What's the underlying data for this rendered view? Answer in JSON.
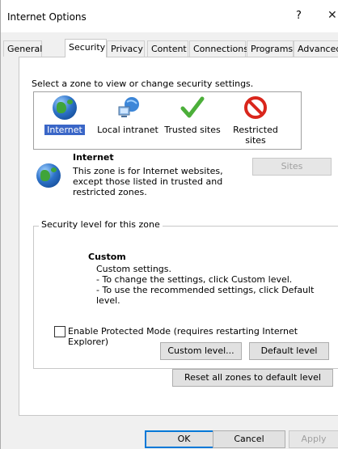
{
  "window": {
    "title": "Internet Options",
    "help_glyph": "?",
    "close_glyph": "✕"
  },
  "tabs": [
    {
      "label": "General",
      "active": false
    },
    {
      "label": "Security",
      "active": true
    },
    {
      "label": "Privacy",
      "active": false
    },
    {
      "label": "Content",
      "active": false
    },
    {
      "label": "Connections",
      "active": false
    },
    {
      "label": "Programs",
      "active": false
    },
    {
      "label": "Advanced",
      "active": false
    }
  ],
  "zones": {
    "prompt": "Select a zone to view or change security settings.",
    "items": [
      {
        "label": "Internet",
        "icon": "globe-icon",
        "selected": true
      },
      {
        "label": "Local intranet",
        "icon": "network-computer-icon",
        "selected": false
      },
      {
        "label": "Trusted sites",
        "icon": "checkmark-icon",
        "selected": false
      },
      {
        "label": "Restricted sites",
        "icon": "no-entry-icon",
        "selected": false
      }
    ]
  },
  "zone_info": {
    "title": "Internet",
    "description": "This zone is for Internet websites, except those listed in trusted and restricted zones.",
    "sites_button": "Sites"
  },
  "security_level": {
    "legend": "Security level for this zone",
    "level_title": "Custom",
    "level_desc_1": "Custom settings.",
    "level_desc_2": "- To change the settings, click Custom level.",
    "level_desc_3": "- To use the recommended settings, click Default level.",
    "protected_mode_label": "Enable Protected Mode (requires restarting Internet Explorer)",
    "protected_mode_checked": false,
    "custom_level_button": "Custom level...",
    "default_level_button": "Default level"
  },
  "reset_all_button": "Reset all zones to default level",
  "footer": {
    "ok": "OK",
    "cancel": "Cancel",
    "apply": "Apply"
  },
  "colors": {
    "selection": "#3a66c7",
    "check_green": "#4caf3a",
    "restricted_red": "#d9261c"
  }
}
